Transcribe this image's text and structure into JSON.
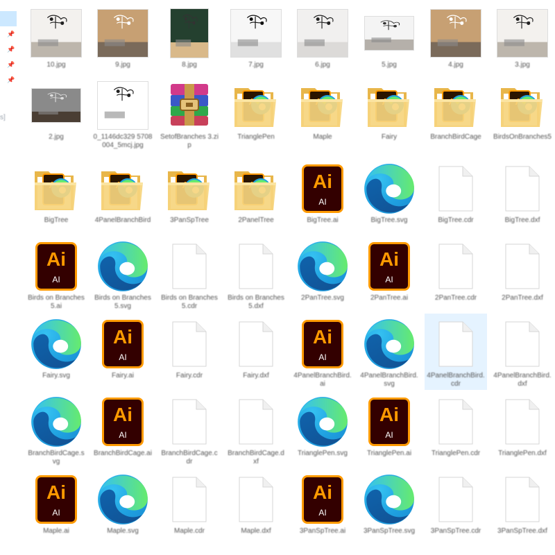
{
  "window": {
    "title": ""
  },
  "nav": {
    "fragment_text": "s]"
  },
  "colors": {
    "selection": "#e5f3ff",
    "ai_border": "#ff9a00",
    "ai_bg": "#330000",
    "folder": "#f6d57e"
  },
  "items": [
    {
      "type": "photo",
      "label": "10.jpg",
      "variant": "room-light"
    },
    {
      "type": "photo",
      "label": "9.jpg",
      "variant": "room-brown"
    },
    {
      "type": "photo",
      "label": "8.jpg",
      "variant": "bag"
    },
    {
      "type": "photo",
      "label": "7.jpg",
      "variant": "panels"
    },
    {
      "type": "photo",
      "label": "6.jpg",
      "variant": "shelf"
    },
    {
      "type": "photo",
      "label": "5.jpg",
      "variant": "wide-room"
    },
    {
      "type": "photo",
      "label": "4.jpg",
      "variant": "room-brown"
    },
    {
      "type": "photo",
      "label": "3.jpg",
      "variant": "room-light"
    },
    {
      "type": "photo",
      "label": "2.jpg",
      "variant": "conference"
    },
    {
      "type": "photo",
      "label": "0_1146dc329 5708004_5mcj.jpg",
      "variant": "sheet"
    },
    {
      "type": "archive",
      "label": "SetofBranches 3.zip"
    },
    {
      "type": "folder",
      "label": "TrianglePen"
    },
    {
      "type": "folder",
      "label": "Maple"
    },
    {
      "type": "folder",
      "label": "Fairy"
    },
    {
      "type": "folder",
      "label": "BranchBirdCage"
    },
    {
      "type": "folder",
      "label": "BirdsOnBranches5"
    },
    {
      "type": "folder",
      "label": "BigTree"
    },
    {
      "type": "folder",
      "label": "4PanelBranchBird"
    },
    {
      "type": "folder",
      "label": "3PanSpTree"
    },
    {
      "type": "folder",
      "label": "2PanelTree"
    },
    {
      "type": "ai",
      "label": "BigTree.ai"
    },
    {
      "type": "edge",
      "label": "BigTree.svg"
    },
    {
      "type": "file",
      "label": "BigTree.cdr"
    },
    {
      "type": "file",
      "label": "BigTree.dxf"
    },
    {
      "type": "ai",
      "label": "Birds on Branches5.ai"
    },
    {
      "type": "edge",
      "label": "Birds on Branches5.svg"
    },
    {
      "type": "file",
      "label": "Birds on Branches5.cdr"
    },
    {
      "type": "file",
      "label": "Birds on Branches5.dxf"
    },
    {
      "type": "edge",
      "label": "2PanTree.svg"
    },
    {
      "type": "ai",
      "label": "2PanTree.ai"
    },
    {
      "type": "file",
      "label": "2PanTree.cdr"
    },
    {
      "type": "file",
      "label": "2PanTree.dxf"
    },
    {
      "type": "edge",
      "label": "Fairy.svg"
    },
    {
      "type": "ai",
      "label": "Fairy.ai"
    },
    {
      "type": "file",
      "label": "Fairy.cdr"
    },
    {
      "type": "file",
      "label": "Fairy.dxf"
    },
    {
      "type": "ai",
      "label": "4PanelBranchBird.ai"
    },
    {
      "type": "edge",
      "label": "4PanelBranchBird.svg"
    },
    {
      "type": "file",
      "label": "4PanelBranchBird.cdr",
      "selected": true
    },
    {
      "type": "file",
      "label": "4PanelBranchBird.dxf"
    },
    {
      "type": "edge",
      "label": "BranchBirdCage.svg"
    },
    {
      "type": "ai",
      "label": "BranchBirdCage.ai"
    },
    {
      "type": "file",
      "label": "BranchBirdCage.cdr"
    },
    {
      "type": "file",
      "label": "BranchBirdCage.dxf"
    },
    {
      "type": "edge",
      "label": "TrianglePen.svg"
    },
    {
      "type": "ai",
      "label": "TrianglePen.ai"
    },
    {
      "type": "file",
      "label": "TrianglePen.cdr"
    },
    {
      "type": "file",
      "label": "TrianglePen.dxf"
    },
    {
      "type": "ai",
      "label": "Maple.ai"
    },
    {
      "type": "edge",
      "label": "Maple.svg"
    },
    {
      "type": "file",
      "label": "Maple.cdr"
    },
    {
      "type": "file",
      "label": "Maple.dxf"
    },
    {
      "type": "ai",
      "label": "3PanSpTree.ai"
    },
    {
      "type": "edge",
      "label": "3PanSpTree.svg"
    },
    {
      "type": "file",
      "label": "3PanSpTree.cdr"
    },
    {
      "type": "file",
      "label": "3PanSpTree.dxf"
    }
  ]
}
